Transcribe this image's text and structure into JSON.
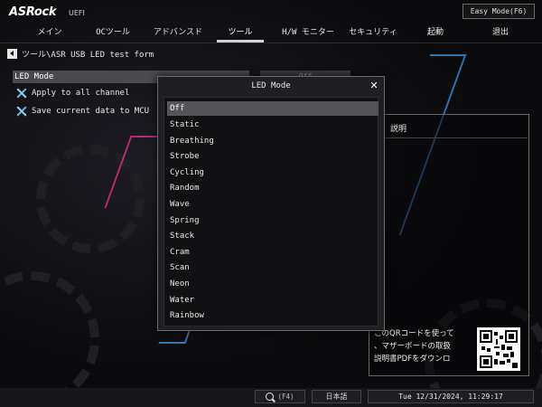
{
  "header": {
    "logo": "ASRock",
    "logo_sub": "UEFI",
    "easy_mode_label": "Easy Mode(F6)"
  },
  "menu": {
    "items": [
      {
        "label": "メイン"
      },
      {
        "label": "OCツール"
      },
      {
        "label": "アドバンスド"
      },
      {
        "label": "ツール"
      },
      {
        "label": "H/W モニター"
      },
      {
        "label": "セキュリティ"
      },
      {
        "label": "起動"
      },
      {
        "label": "退出"
      }
    ],
    "active": "ツール"
  },
  "breadcrumb": {
    "path": "ツール\\ASR USB LED test form"
  },
  "options": {
    "led_mode_label": "LED Mode",
    "led_mode_value": "Off",
    "apply_label": "Apply to all channel",
    "save_label": "Save current data to MCU"
  },
  "description": {
    "title": "説明",
    "qr_lines": [
      "このQRコードを使って",
      "、マザーボードの取扱",
      "説明書PDFをダウンロ"
    ]
  },
  "modal": {
    "title": "LED Mode",
    "close_icon": "close-icon",
    "selected": "Off",
    "options": [
      "Off",
      "Static",
      "Breathing",
      "Strobe",
      "Cycling",
      "Random",
      "Wave",
      "Spring",
      "Stack",
      "Cram",
      "Scan",
      "Neon",
      "Water",
      "Rainbow"
    ]
  },
  "footer": {
    "search_key": "(F4)",
    "language": "日本語",
    "datetime": "Tue 12/31/2024, 11:29:17"
  },
  "colors": {
    "background": "#0b0b0d",
    "selected_item": "#555559",
    "highlight_row": "#4a4a4d",
    "accent_tool_icon": "#5fb6e8",
    "neon_pink": "#e0308a",
    "neon_blue": "#3a8fe0"
  }
}
